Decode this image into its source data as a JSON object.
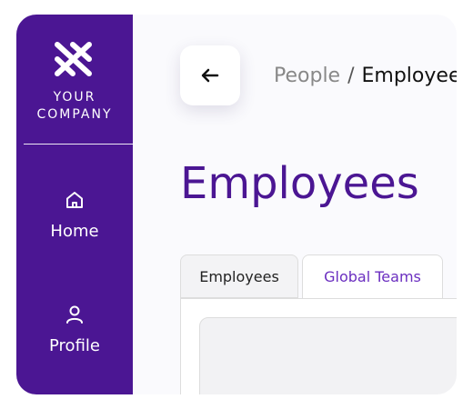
{
  "sidebar": {
    "company": "YOUR\nCOMPANY",
    "items": [
      {
        "label": "Home",
        "icon": "home-icon"
      },
      {
        "label": "Profile",
        "icon": "user-icon"
      }
    ]
  },
  "header": {
    "back_icon": "arrow-left-icon",
    "breadcrumb": {
      "parent": "People",
      "separator": "/",
      "current": "Employees"
    }
  },
  "main": {
    "title": "Employees",
    "tabs": [
      {
        "label": "Employees",
        "active": false
      },
      {
        "label": "Global Teams",
        "active": true
      }
    ]
  },
  "colors": {
    "brand": "#4b1693",
    "accent": "#6b2fc0",
    "background": "#fafafd"
  }
}
